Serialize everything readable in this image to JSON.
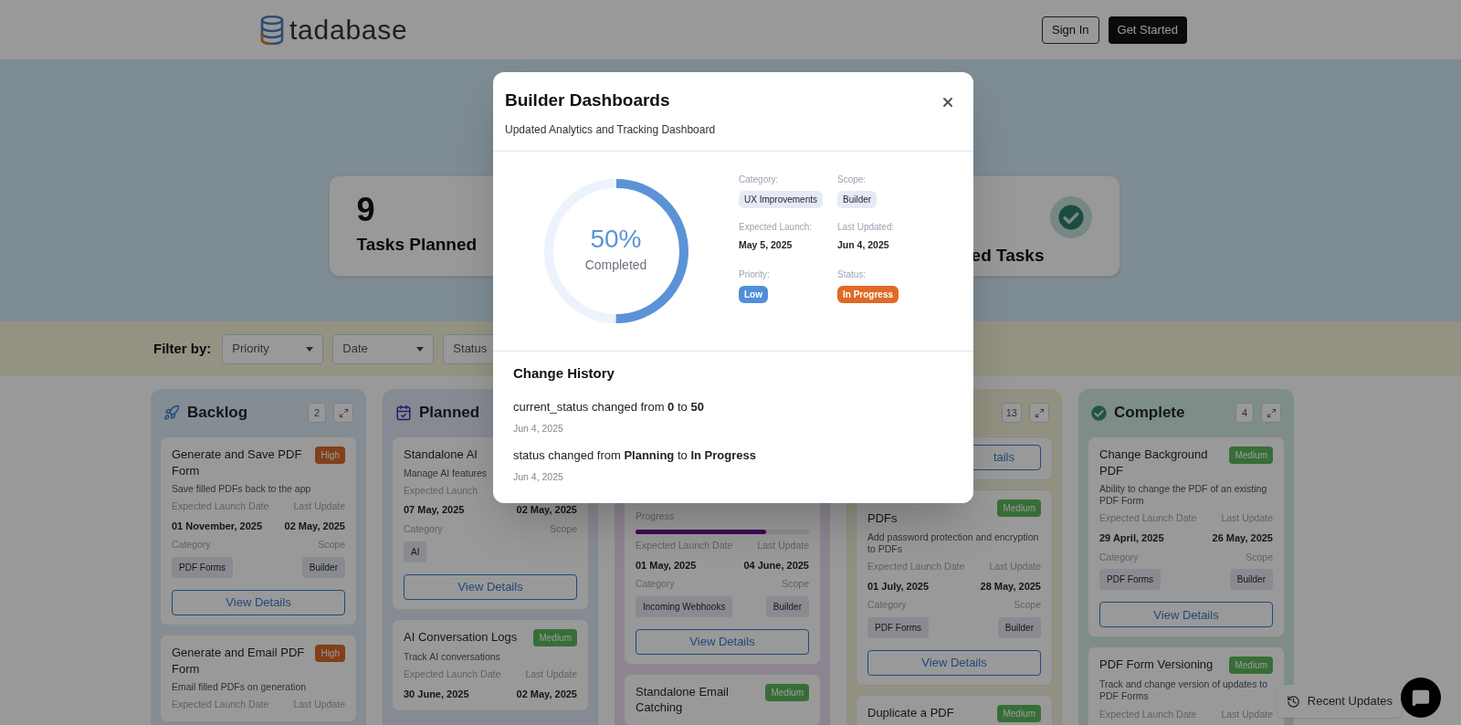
{
  "header": {
    "logo": "tadabase",
    "buttons": [
      {
        "label": "Sign In",
        "kind": "outline"
      },
      {
        "label": "Get Started",
        "kind": "solid"
      }
    ]
  },
  "stats": [
    {
      "value": "9",
      "label": "Tasks Planned",
      "kind": "plain"
    },
    {
      "label": "ed Tasks",
      "kind": "check"
    }
  ],
  "filter": {
    "label": "Filter by:",
    "dropdowns": [
      "Priority",
      "Date",
      "Status"
    ]
  },
  "columns": [
    {
      "kind": "backlog",
      "title": "Backlog",
      "count": "2",
      "cards": [
        {
          "title": "Generate and Save PDF Form",
          "badge": {
            "text": "High",
            "kind": "high"
          },
          "description": "Save filled PDFs back to the app",
          "date_labels": [
            "Expected Launch Date",
            "Last Update"
          ],
          "dates": [
            "01 November, 2025",
            "02 May, 2025"
          ],
          "meta_labels": [
            "Category",
            "Scope"
          ],
          "tags": [
            "PDF Forms",
            "Builder"
          ],
          "button": "View Details"
        },
        {
          "title": "Generate and Email PDF Form",
          "badge": {
            "text": "High",
            "kind": "high"
          },
          "description": "Email filled PDFs on generation",
          "date_labels": [
            "Expected Launch Date",
            "Last Update"
          ]
        }
      ]
    },
    {
      "kind": "planned",
      "title": "Planned",
      "cards": [
        {
          "title": "Standalone AI",
          "description": "Manage AI features",
          "date_labels": [
            "Expected Launch"
          ],
          "dates": [
            "07 May, 2025",
            "02 May, 2025"
          ],
          "meta_labels": [
            "Category",
            "Scope"
          ],
          "tags": [
            "AI"
          ],
          "button": "View Details"
        },
        {
          "title": "AI Conversation Logs",
          "badge": {
            "text": "Medium",
            "kind": "medium"
          },
          "description": "Track AI conversations",
          "date_labels": [
            "Expected Launch Date",
            "Last Update"
          ],
          "dates": [
            "30 June, 2025",
            "02 May, 2025"
          ]
        }
      ]
    },
    {
      "kind": "progress",
      "cards": [
        {
          "progress": {
            "label": "Progress",
            "level": 0.75
          },
          "date_labels": [
            "Expected Launch Date",
            "Last Update"
          ],
          "dates": [
            "01 May, 2025",
            "04 June, 2025"
          ],
          "meta_labels": [
            "Category",
            "Scope"
          ],
          "tags": [
            "Incoming Webhooks",
            "Builder"
          ],
          "button": "View Details"
        },
        {
          "title": "Standalone Email Catching",
          "badge": {
            "text": "Medium",
            "kind": "medium"
          }
        }
      ]
    },
    {
      "kind": "review",
      "count": "13",
      "cards": [
        {
          "button": "tails"
        },
        {
          "title": "PDFs",
          "badge": {
            "text": "Medium",
            "kind": "medium"
          },
          "description": "Add password protection and encryption to PDFs",
          "date_labels": [
            "Expected Launch Date",
            "Last Update"
          ],
          "dates": [
            "01 July, 2025",
            "28 May, 2025"
          ],
          "meta_labels": [
            "Category",
            "Scope"
          ],
          "tags": [
            "PDF Forms",
            "Builder"
          ],
          "button": "View Details"
        },
        {
          "title": "Duplicate a PDF",
          "badge": {
            "text": "Medium",
            "kind": "medium"
          }
        }
      ]
    },
    {
      "kind": "complete",
      "title": "Complete",
      "count": "4",
      "cards": [
        {
          "title": "Change Background PDF",
          "badge": {
            "text": "Medium",
            "kind": "medium"
          },
          "description": "Ability to change the PDF of an existing PDF Form",
          "date_labels": [
            "Expected Launch Date",
            "Last Update"
          ],
          "dates": [
            "29 April, 2025",
            "26 May, 2025"
          ],
          "meta_labels": [
            "Category",
            "Scope"
          ],
          "tags": [
            "PDF Forms",
            "Builder"
          ],
          "button": "View Details"
        },
        {
          "title": "PDF Form Versioning",
          "badge": {
            "text": "Medium",
            "kind": "medium"
          },
          "description": "Track and change version of updates to PDF Forms",
          "date_labels": [
            "Expected Launch Date",
            "Last Update"
          ]
        }
      ]
    }
  ],
  "recent_updates": "Recent Updates",
  "modal": {
    "title": "Builder Dashboards",
    "subtitle": "Updated Analytics and Tracking Dashboard",
    "progress": {
      "value": "50%",
      "label": "Completed",
      "level": 0.5
    },
    "fields": [
      {
        "label": "Category:",
        "value": "UX Improvements",
        "kind": "chip"
      },
      {
        "label": "Scope:",
        "value": "Builder",
        "kind": "chip"
      },
      {
        "label": "Expected Launch:",
        "value": "May 5, 2025",
        "kind": "text"
      },
      {
        "label": "Last Updated:",
        "value": "Jun 4, 2025",
        "kind": "text"
      },
      {
        "label": "Priority:",
        "value": "Low",
        "kind": "badge",
        "color": "#4f8fd8"
      },
      {
        "label": "Status:",
        "value": "In Progress",
        "kind": "badge",
        "color": "#e06a25"
      }
    ],
    "history_title": "Change History",
    "history": [
      {
        "text": "current_status changed from **0** to **50**",
        "date": "Jun 4, 2025"
      },
      {
        "text": "status changed from **Planning** to **In Progress**",
        "date": "Jun 4, 2025"
      }
    ]
  }
}
